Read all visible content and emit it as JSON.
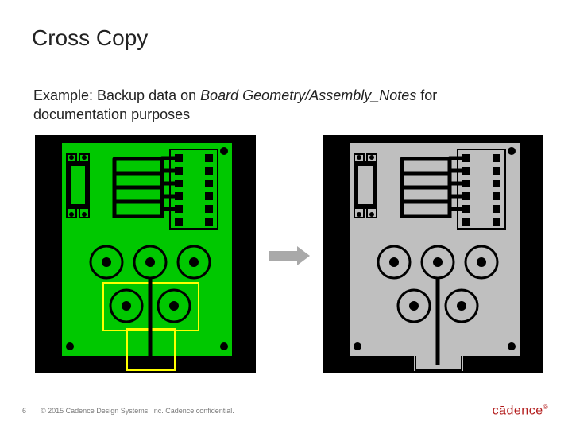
{
  "slide": {
    "title": "Cross Copy",
    "subtitle_pre": "Example: Backup data  on ",
    "subtitle_italic": "Board Geometry/Assembly_Notes",
    "subtitle_post": " for documentation purposes"
  },
  "footer": {
    "page_number": "6",
    "copyright": "© 2015 Cadence Design Systems, Inc. Cadence confidential."
  },
  "logo": {
    "text": "cādence",
    "mark": "®"
  },
  "panels": {
    "left": {
      "fill": "#00c800",
      "highlight": "#ffff00",
      "bg": "#000"
    },
    "right": {
      "fill": "#bfbfbf",
      "highlight": "#bfbfbf",
      "bg": "#000"
    }
  }
}
